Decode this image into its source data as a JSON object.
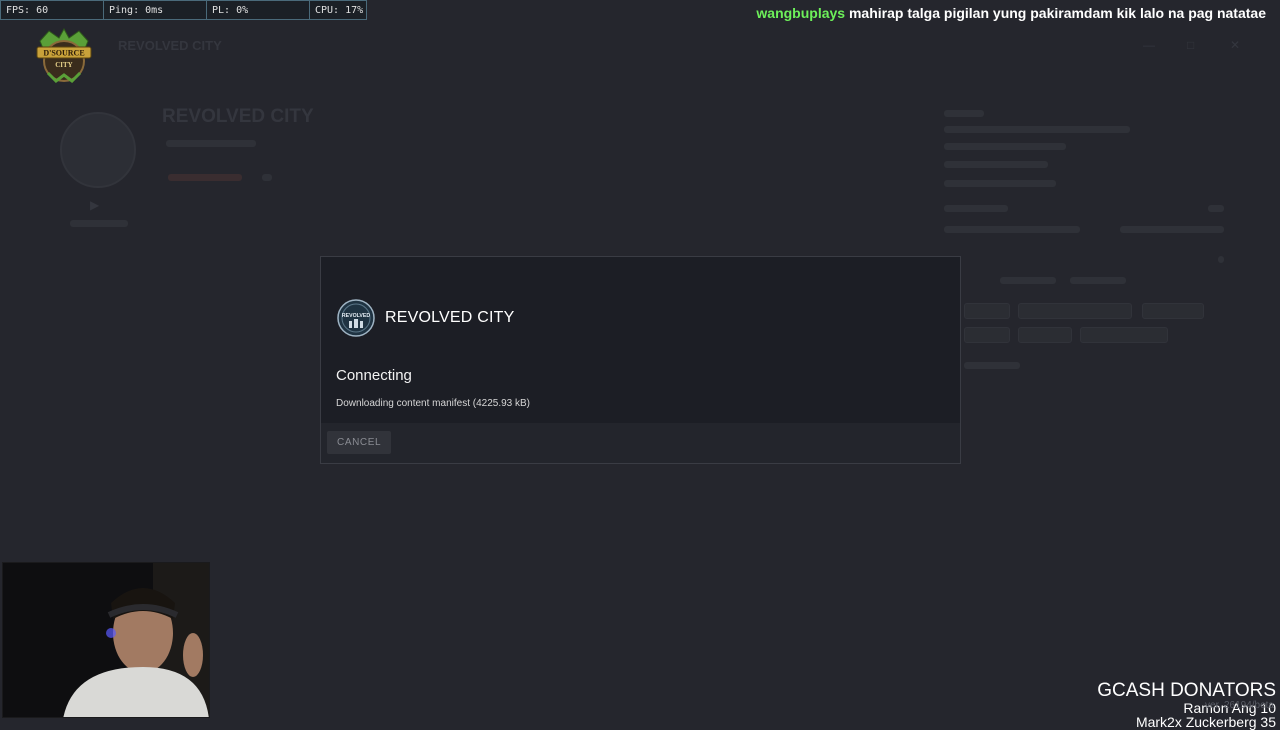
{
  "perf": {
    "fps": "FPS: 60",
    "ping": "Ping: 0ms",
    "pl": "PL: 0%",
    "cpu": "CPU: 17%"
  },
  "chat": {
    "username": "wangbuplays",
    "message": "mahirap talga pigilan yung pakiramdam kik lalo na pag natatae"
  },
  "logo": {
    "top_text": "D'SOURCE",
    "bottom_text": "CITY"
  },
  "dialog": {
    "server_icon_text": "REVOLVED",
    "title": "REVOLVED CITY",
    "status": "Connecting",
    "detail": "Downloading content manifest (4225.93 kB)",
    "cancel_label": "CANCEL"
  },
  "overlay": {
    "donators_title": "GCASH DONATORS",
    "donator_lines": [
      "Ramon Ang 10",
      "Mark2x Zuckerberg 35"
    ],
    "version": "ver. 26194/beta"
  },
  "colors": {
    "background": "#25262d",
    "dialog": "#1c1e25",
    "chat_user": "#6df05a"
  }
}
